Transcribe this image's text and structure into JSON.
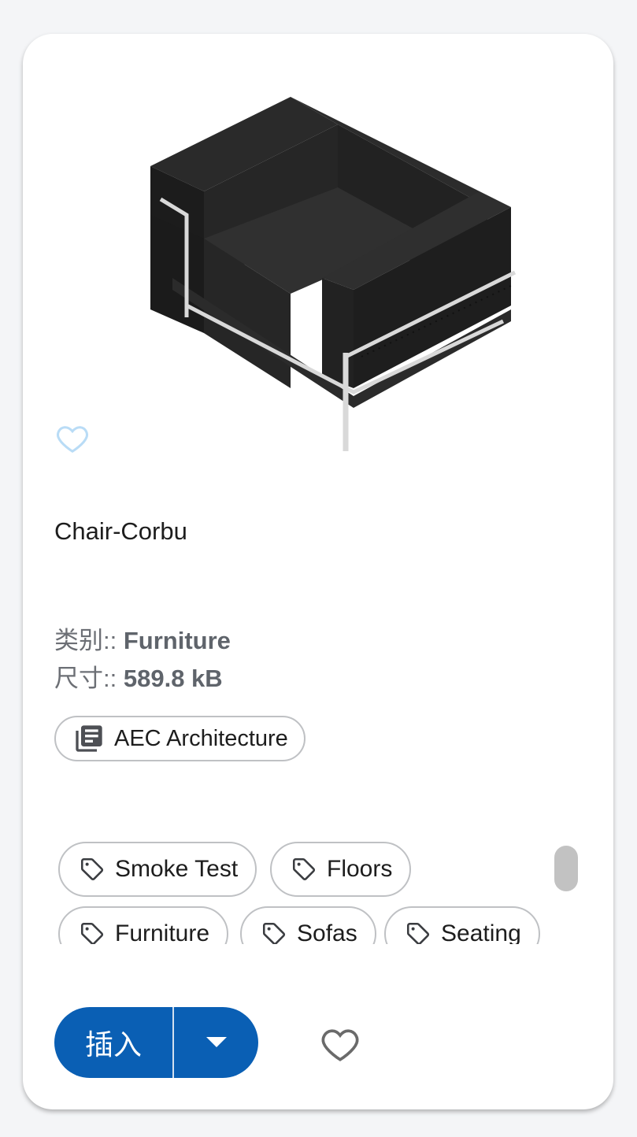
{
  "card": {
    "title": "Chair-Corbu",
    "category_label": "类别::",
    "category_value": "Furniture",
    "size_label": "尺寸::",
    "size_value": "589.8 kB",
    "library": "AEC Architecture",
    "tags": [
      "Smoke Test",
      "Floors",
      "Furniture",
      "Sofas",
      "Seating"
    ],
    "insert_label": "插入",
    "thumbnail_icon": "chair-thumbnail",
    "favorite_icon": "heart-outline-icon",
    "library_icon": "library-books-icon",
    "tag_icon": "tag-icon",
    "dropdown_icon": "caret-down-icon"
  },
  "colors": {
    "primary": "#0a5fb4",
    "thumb_favorite": "#b9dcf6",
    "chip_border": "#bfc1c4",
    "meta_text": "#6c6f75"
  }
}
